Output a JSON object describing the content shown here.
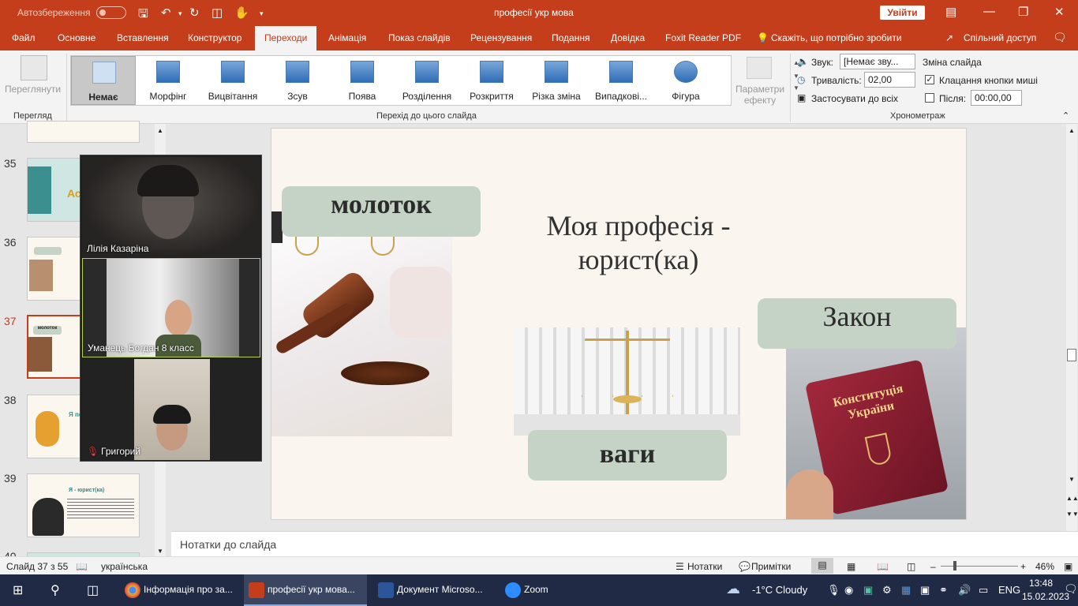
{
  "titlebar": {
    "autosave_label": "Автозбереження",
    "document_title": "професії укр мова",
    "signin_label": "Увійти"
  },
  "tabs": [
    "Файл",
    "Основне",
    "Вставлення",
    "Конструктор",
    "Переходи",
    "Анімація",
    "Показ слайдів",
    "Рецензування",
    "Подання",
    "Довідка",
    "Foxit Reader PDF"
  ],
  "active_tab": "Переходи",
  "tell_me": "Скажіть, що потрібно зробити",
  "share_label": "Спільний доступ",
  "ribbon": {
    "preview_label": "Переглянути",
    "preview_group": "Перегляд",
    "transitions_group": "Перехід до цього слайда",
    "transitions": [
      "Немає",
      "Морфінг",
      "Вицвітання",
      "Зсув",
      "Поява",
      "Розділення",
      "Розкриття",
      "Різка зміна",
      "Випадкові...",
      "Фігура"
    ],
    "effect_options": "Параметри ефекту",
    "sound_label": "Звук:",
    "sound_value": "[Немає зву...",
    "duration_label": "Тривалість:",
    "duration_value": "02,00",
    "apply_all": "Застосувати до всіх",
    "advance_title": "Зміна слайда",
    "on_click": "Клацання кнопки миші",
    "on_click_checked": true,
    "after_label": "Після:",
    "after_value": "00:00,00",
    "after_checked": false,
    "timing_group": "Хронометраж"
  },
  "thumbnails": [
    {
      "num": "35",
      "text": "Асо"
    },
    {
      "num": "36",
      "text": ""
    },
    {
      "num": "37",
      "text": "молоток"
    },
    {
      "num": "38",
      "text": "Я потр"
    },
    {
      "num": "39",
      "text": "Я - юрист(ка)"
    },
    {
      "num": "40",
      "text": ""
    }
  ],
  "current_slide_index": 2,
  "zoom": {
    "participants": [
      "Лілія Казаріна",
      "Уманець Богдан 8 класс",
      "Григорий"
    ]
  },
  "slide": {
    "title": "Моя професія - юрист(ка)",
    "labels": {
      "hammer": "молоток",
      "law": "Закон",
      "scales": "ваги"
    },
    "book_text": "Конституція України"
  },
  "notes_placeholder": "Нотатки до слайда",
  "status": {
    "slide_info": "Слайд 37 з 55",
    "language": "українська",
    "notes_btn": "Нотатки",
    "comments_btn": "Примітки",
    "zoom_pct": "46%"
  },
  "taskbar": {
    "apps": [
      {
        "label": "Інформація про за...",
        "color": "#e8b23a"
      },
      {
        "label": "професії укр мова...",
        "color": "#c43e1c"
      },
      {
        "label": "Документ Microso...",
        "color": "#2b579a"
      },
      {
        "label": "Zoom",
        "color": "#2d8cff"
      }
    ],
    "weather": "-1°C  Cloudy",
    "lang": "ENG",
    "time": "13:48",
    "date": "15.02.2023"
  }
}
